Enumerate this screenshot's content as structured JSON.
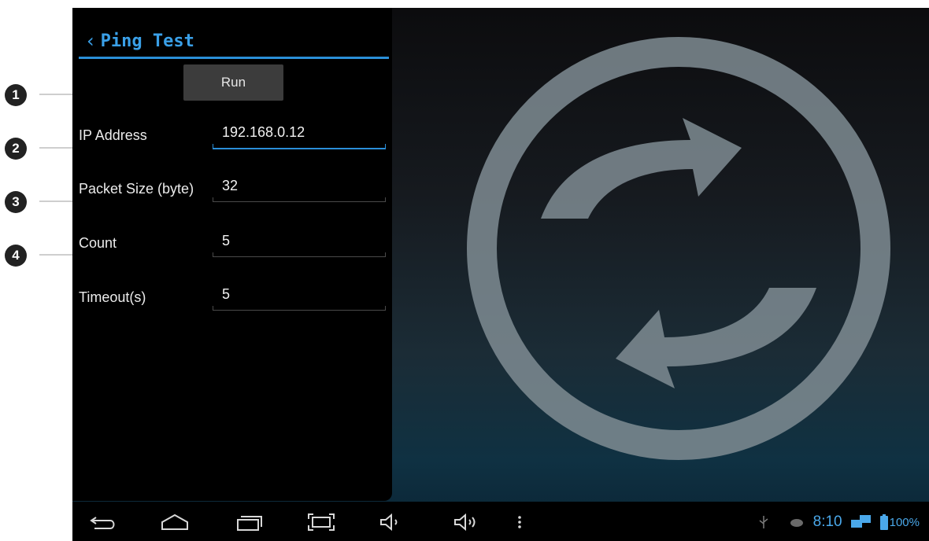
{
  "callouts": [
    "1",
    "2",
    "3",
    "4"
  ],
  "panel": {
    "title": "Ping Test",
    "run_label": "Run"
  },
  "fields": [
    {
      "label": "IP Address",
      "value": "192.168.0.12",
      "active": true
    },
    {
      "label": "Packet Size (byte)",
      "value": "32",
      "active": false
    },
    {
      "label": "Count",
      "value": "5",
      "active": false
    },
    {
      "label": "Timeout(s)",
      "value": "5",
      "active": false
    }
  ],
  "navbar": {
    "buttons": [
      "back-icon",
      "home-icon",
      "recent-apps-icon",
      "screenshot-icon",
      "volume-down-icon",
      "volume-up-icon",
      "menu-icon"
    ]
  },
  "status": {
    "icons": [
      "usb-icon",
      "debug-icon",
      "network-icon",
      "battery-icon"
    ],
    "time": "8:10",
    "battery": "100%"
  },
  "colors": {
    "accent": "#2a8fd8",
    "title": "#3aa0e8",
    "panel_bg": "#000000",
    "button_bg": "#3c3c3c"
  }
}
